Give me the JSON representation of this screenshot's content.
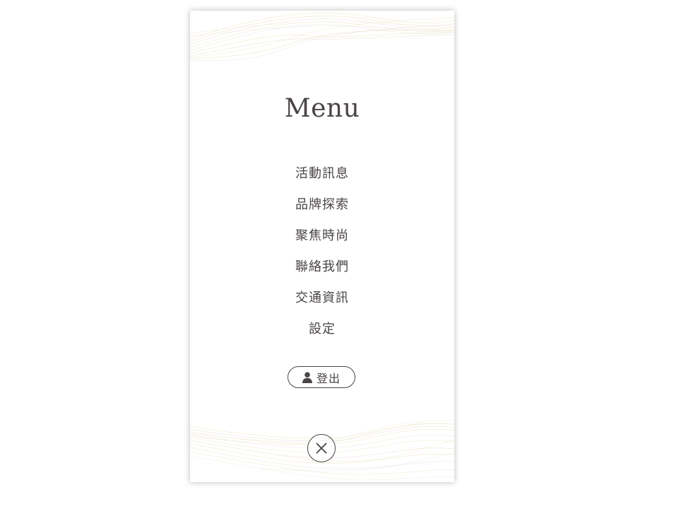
{
  "menu": {
    "title": "Menu",
    "items": [
      {
        "label": "活動訊息"
      },
      {
        "label": "品牌探索"
      },
      {
        "label": "聚焦時尚"
      },
      {
        "label": "聯絡我們"
      },
      {
        "label": "交通資訊"
      },
      {
        "label": "設定"
      }
    ],
    "logout_label": "登出"
  },
  "icons": {
    "logout": "user-icon",
    "close": "close-icon"
  },
  "colors": {
    "text": "#4a4446",
    "wave_gold": "#e8d9a8",
    "wave_gray": "#d8d4d0",
    "background": "#ffffff"
  }
}
